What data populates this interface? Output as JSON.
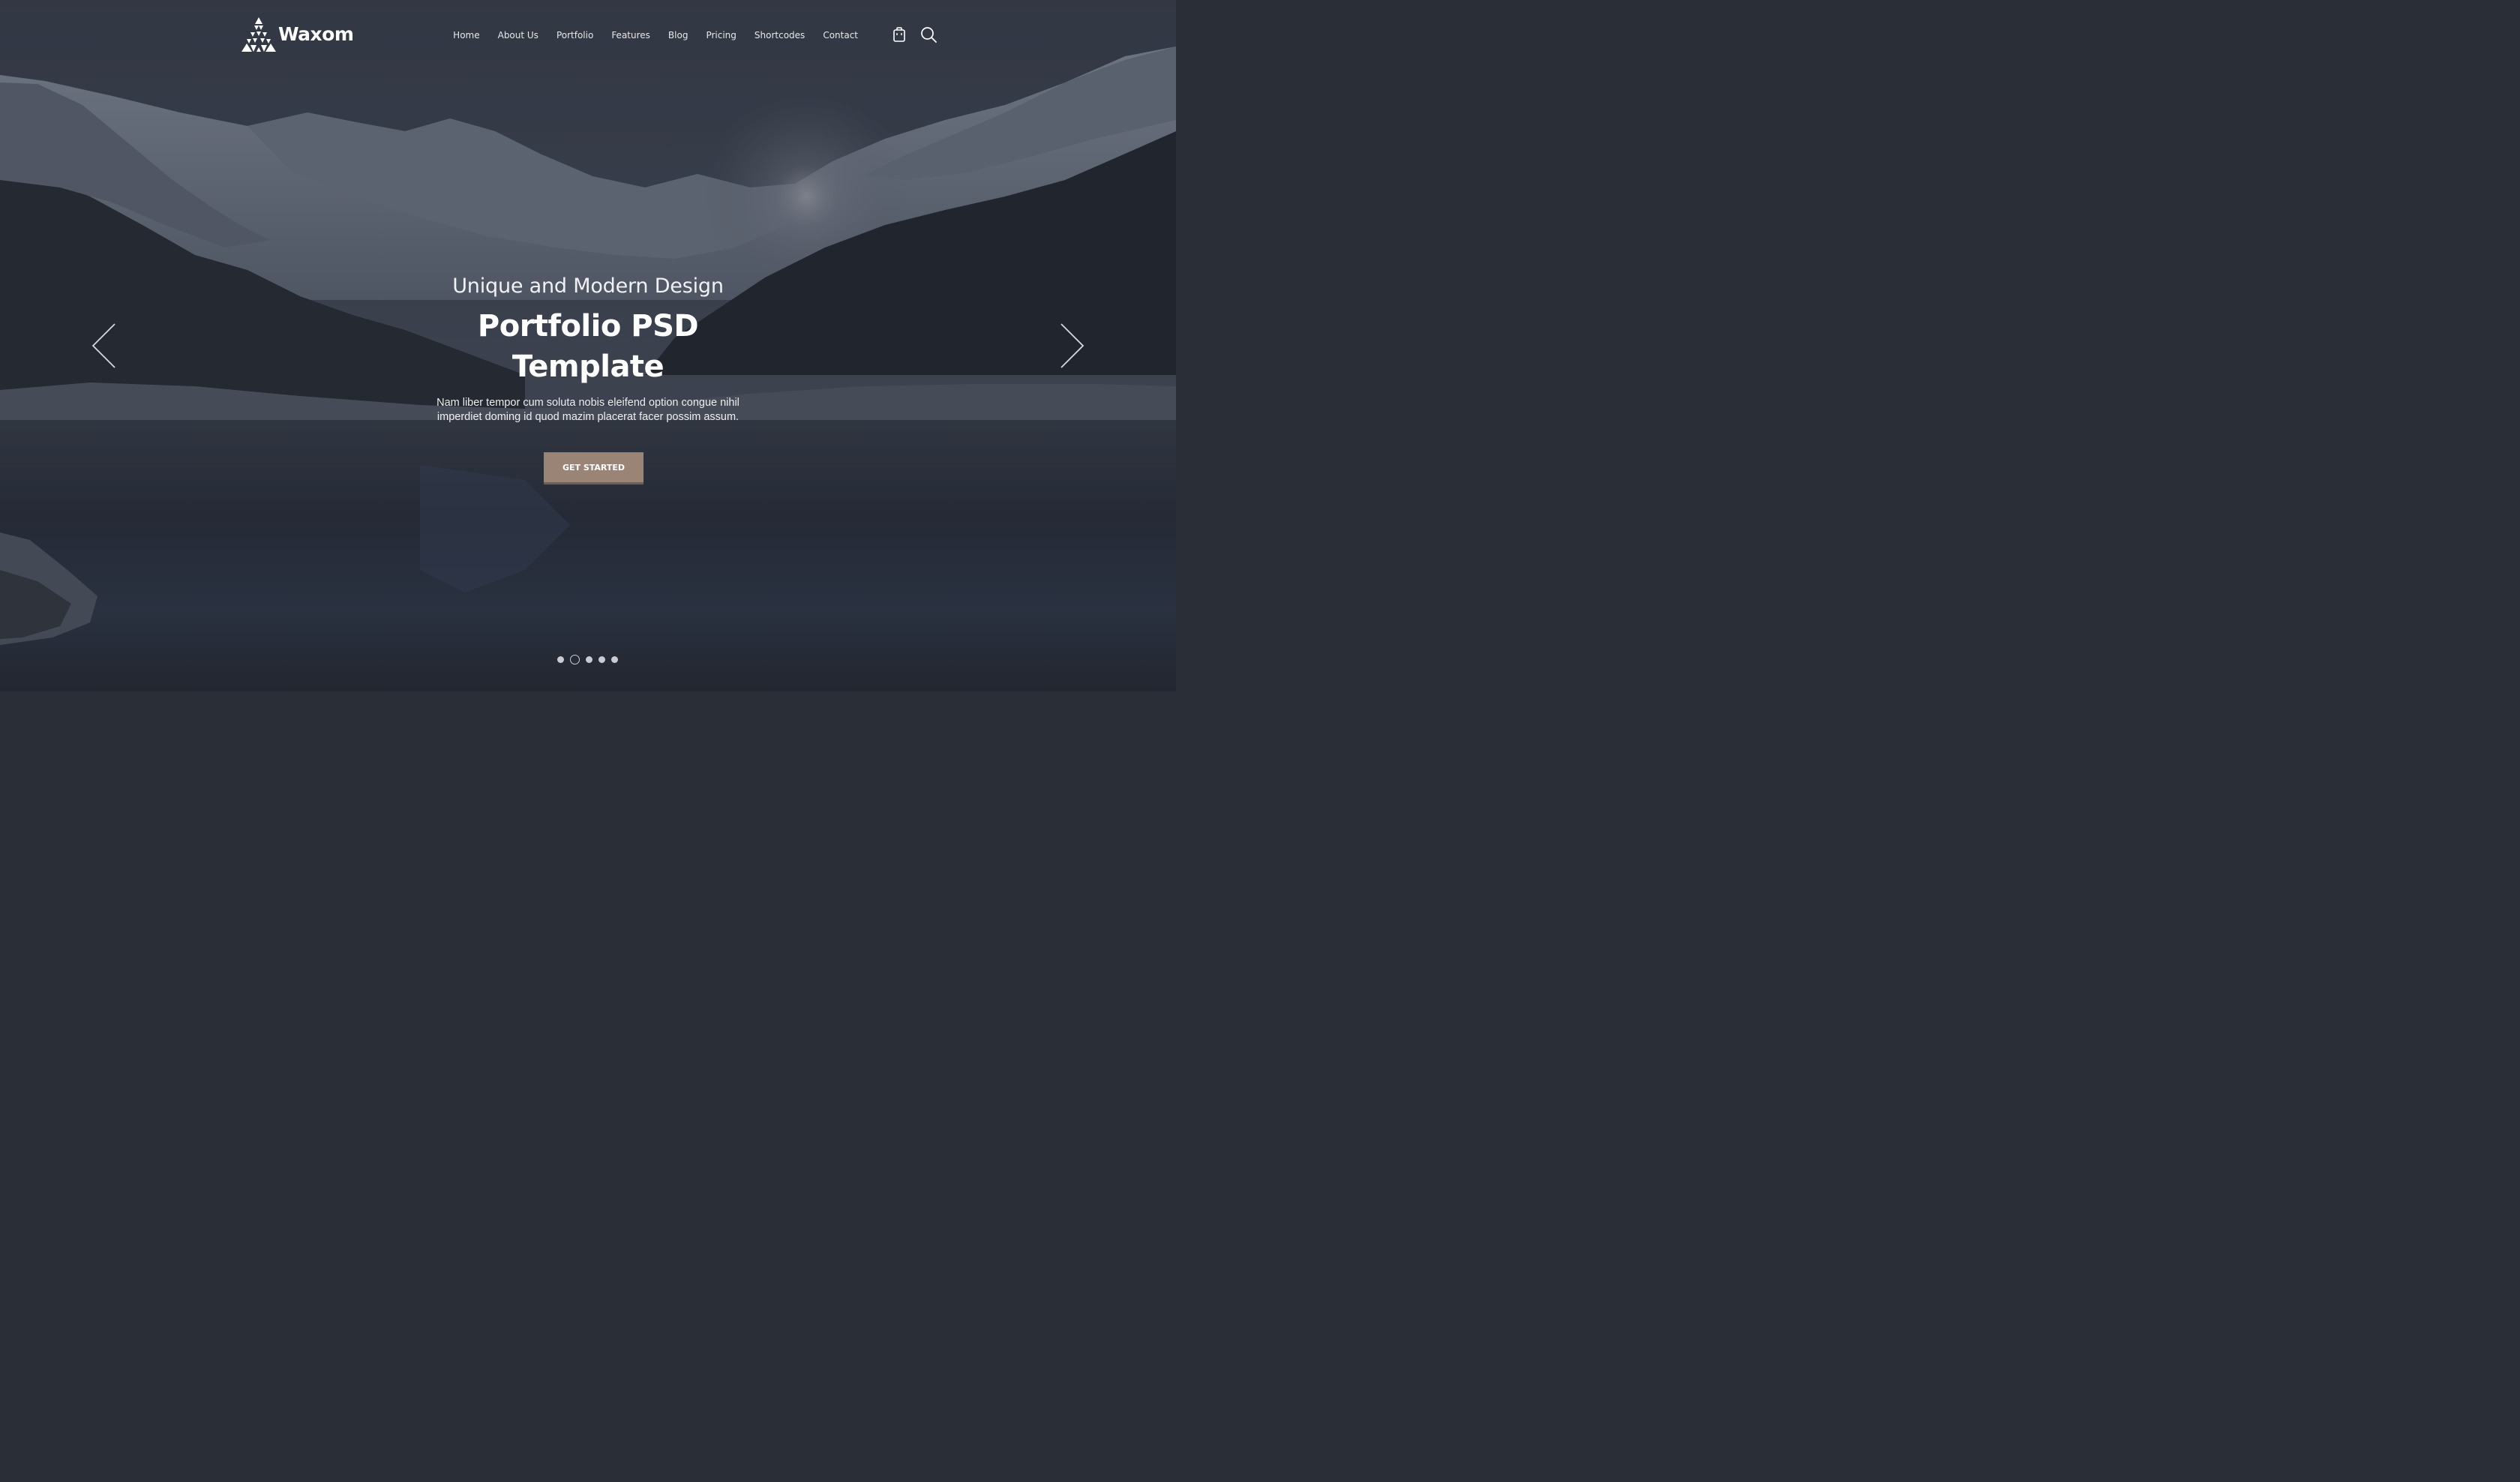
{
  "brand": {
    "name": "Waxom",
    "logo_icon": "triangle-mosaic-logo-icon"
  },
  "nav": {
    "items": [
      {
        "label": "Home"
      },
      {
        "label": "About Us"
      },
      {
        "label": "Portfolio"
      },
      {
        "label": "Features"
      },
      {
        "label": "Blog"
      },
      {
        "label": "Pricing"
      },
      {
        "label": "Shortcodes"
      },
      {
        "label": "Contact"
      }
    ],
    "cart_icon": "shopping-bag-icon",
    "search_icon": "search-icon"
  },
  "hero": {
    "subtitle": "Unique and Modern Design",
    "title_line1": "Portfolio PSD",
    "title_line2": "Template",
    "description": "Nam liber tempor cum soluta nobis eleifend option congue nihil imperdiet doming id quod mazim placerat facer possim assum.",
    "cta_label": "GET STARTED",
    "prev_icon": "chevron-left-icon",
    "next_icon": "chevron-right-icon"
  },
  "slider": {
    "total_slides": 5,
    "active_index": 1
  },
  "colors": {
    "accent": "#9a8476",
    "accent_shadow": "#6f5e55",
    "text": "#ffffff",
    "dot": "#c9cbd0"
  }
}
